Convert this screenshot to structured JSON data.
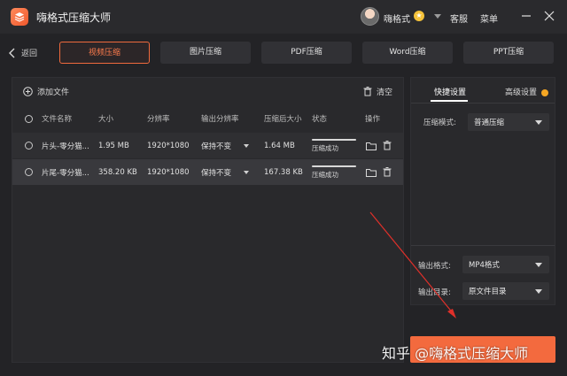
{
  "app": {
    "title": "嗨格式压缩大师"
  },
  "header": {
    "username": "嗨格式",
    "links": [
      "客服",
      "菜单"
    ],
    "window_controls": [
      "minimize-icon",
      "close-icon"
    ]
  },
  "nav": {
    "back_label": "返回"
  },
  "tabs": [
    {
      "label": "视频压缩",
      "active": true
    },
    {
      "label": "图片压缩",
      "active": false
    },
    {
      "label": "PDF压缩",
      "active": false
    },
    {
      "label": "Word压缩",
      "active": false
    },
    {
      "label": "PPT压缩",
      "active": false
    }
  ],
  "toolbar": {
    "add_file": "添加文件",
    "clear": "清空"
  },
  "table": {
    "columns": [
      "文件名称",
      "大小",
      "分辨率",
      "输出分辨率",
      "压缩后大小",
      "状态",
      "操作"
    ],
    "rows": [
      {
        "name": "片头-零分猫...",
        "size": "1.95 MB",
        "resolution": "1920*1080",
        "output_resolution": "保持不变",
        "compressed_size": "1.64 MB",
        "status": "压缩成功",
        "progress": 1.0
      },
      {
        "name": "片尾-零分猫...",
        "size": "358.20 KB",
        "resolution": "1920*1080",
        "output_resolution": "保持不变",
        "compressed_size": "167.38 KB",
        "status": "压缩成功",
        "progress": 1.0
      }
    ]
  },
  "settings": {
    "tab_quick": "快捷设置",
    "tab_advanced": "高级设置",
    "compress_mode_label": "压缩模式:",
    "compress_mode_value": "普通压缩",
    "output_format_label": "输出格式:",
    "output_format_value": "MP4格式",
    "output_dir_label": "输出目录:",
    "output_dir_value": "原文件目录"
  },
  "watermark": "知乎 @嗨格式压缩大师",
  "colors": {
    "accent": "#f36a3e",
    "background": "#232326",
    "panel": "#29292c"
  }
}
